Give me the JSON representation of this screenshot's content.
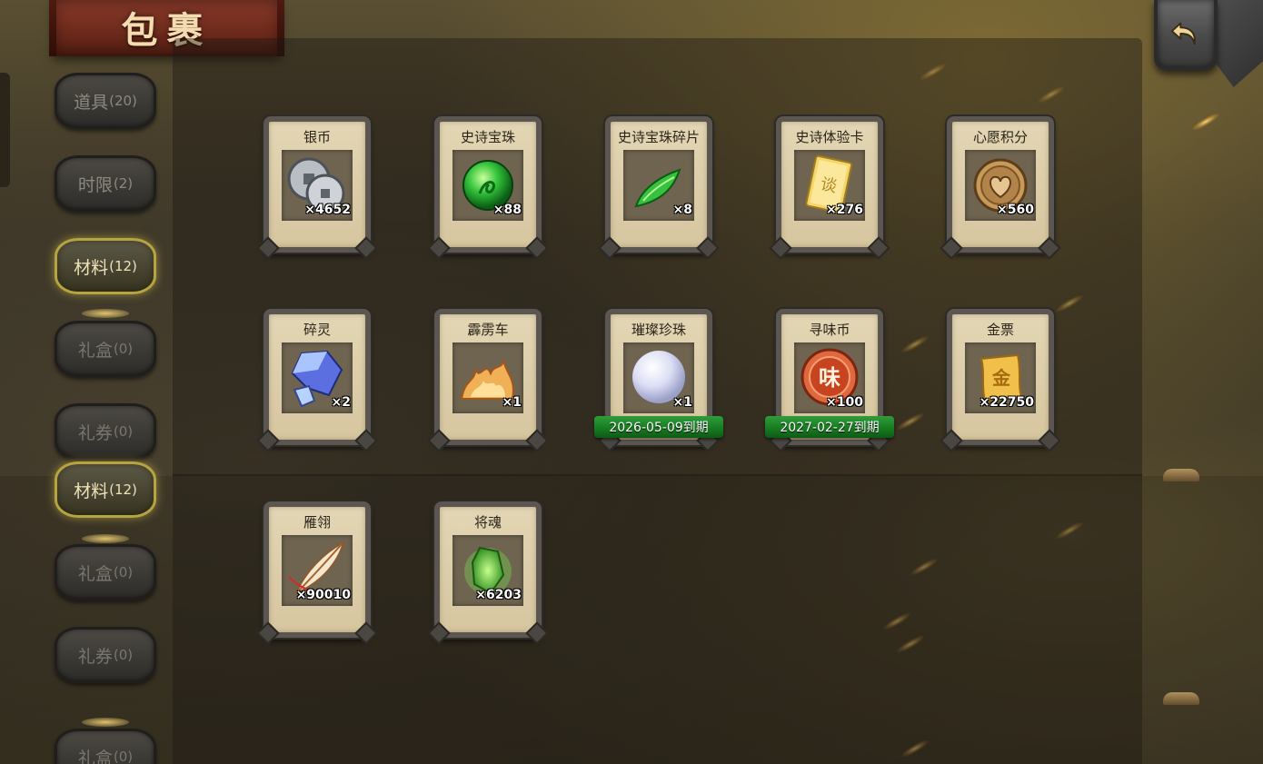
{
  "title": "包裹",
  "back_icon": "return-arrow-icon",
  "sidebar": [
    {
      "label": "道具",
      "count": "(20)",
      "state": "normal"
    },
    {
      "label": "时限",
      "count": "(2)",
      "state": "normal"
    },
    {
      "label": "材料",
      "count": "(12)",
      "state": "active"
    },
    {
      "label": "礼盒",
      "count": "(0)",
      "state": "dim"
    },
    {
      "label": "礼券",
      "count": "(0)",
      "state": "dim"
    },
    {
      "label": "材料",
      "count": "(12)",
      "state": "active"
    },
    {
      "label": "礼盒",
      "count": "(0)",
      "state": "dim"
    },
    {
      "label": "礼券",
      "count": "(0)",
      "state": "dim"
    },
    {
      "label": "礼盒",
      "count": "(0)",
      "state": "dim"
    }
  ],
  "items": [
    {
      "name": "银币",
      "count": "×4652",
      "icon": "silver-coins-icon",
      "expiry": ""
    },
    {
      "name": "史诗宝珠",
      "count": "×88",
      "icon": "green-orb-icon",
      "expiry": ""
    },
    {
      "name": "史诗宝珠碎片",
      "count": "×8",
      "icon": "green-shard-icon",
      "expiry": ""
    },
    {
      "name": "史诗体验卡",
      "count": "×276",
      "icon": "gold-card-icon",
      "expiry": ""
    },
    {
      "name": "心愿积分",
      "count": "×560",
      "icon": "heart-coin-icon",
      "expiry": ""
    },
    {
      "name": "碎灵",
      "count": "×2",
      "icon": "crystal-icon",
      "expiry": ""
    },
    {
      "name": "霹雳车",
      "count": "×1",
      "icon": "fire-cart-icon",
      "expiry": ""
    },
    {
      "name": "璀璨珍珠",
      "count": "×1",
      "icon": "pearl-icon",
      "expiry": "2026-05-09到期"
    },
    {
      "name": "寻味币",
      "count": "×100",
      "icon": "taste-coin-icon",
      "expiry": "2027-02-27到期"
    },
    {
      "name": "金票",
      "count": "×22750",
      "icon": "gold-scroll-icon",
      "expiry": ""
    },
    {
      "name": "雁翎",
      "count": "×90010",
      "icon": "feather-icon",
      "expiry": ""
    },
    {
      "name": "将魂",
      "count": "×6203",
      "icon": "soul-crystal-icon",
      "expiry": ""
    }
  ],
  "icon_glyphs": {
    "taste_coin": "味",
    "gold_scroll": "金",
    "gold_card": "谈"
  },
  "colors": {
    "active_border": "#b7a43e",
    "expiry_green": "#16791f",
    "title_red": "#6e2a1c"
  }
}
